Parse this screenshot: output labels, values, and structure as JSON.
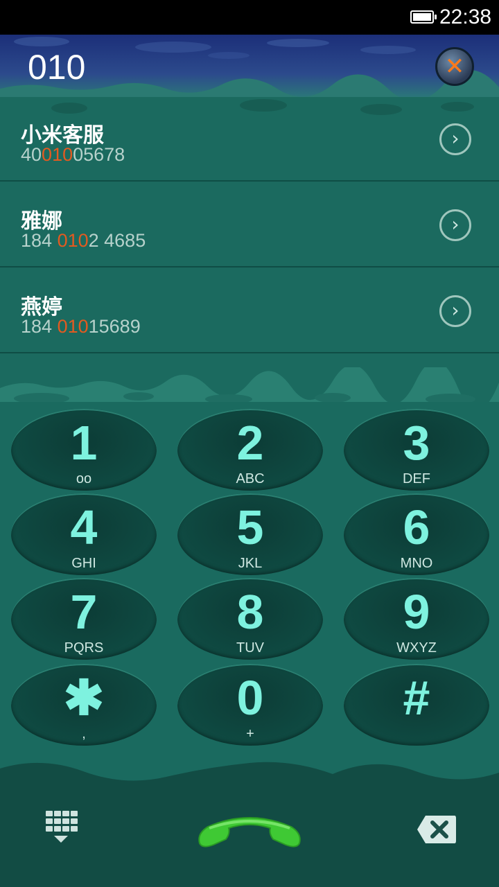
{
  "status_bar": {
    "time": "22:38",
    "battery_level": 1.0,
    "battery_icon": "battery-icon"
  },
  "header": {
    "query": "010",
    "clear_icon": "close-icon",
    "clear_glyph": "✕"
  },
  "results": [
    {
      "name": "小米客服",
      "number_pre": "40",
      "number_match": "010",
      "number_post": "05678"
    },
    {
      "name": "雅娜",
      "number_pre": "184 ",
      "number_match": "010",
      "number_post": "2 4685"
    },
    {
      "name": "燕婷",
      "number_pre": "184 ",
      "number_match": "010",
      "number_post": "15689"
    }
  ],
  "arrow_glyph": "›",
  "keypad": [
    {
      "digit": "1",
      "letters": "ᴏᴏ",
      "letters_icon": "voicemail-icon"
    },
    {
      "digit": "2",
      "letters": "ABC"
    },
    {
      "digit": "3",
      "letters": "DEF"
    },
    {
      "digit": "4",
      "letters": "GHI"
    },
    {
      "digit": "5",
      "letters": "JKL"
    },
    {
      "digit": "6",
      "letters": "MNO"
    },
    {
      "digit": "7",
      "letters": "PQRS"
    },
    {
      "digit": "8",
      "letters": "TUV"
    },
    {
      "digit": "9",
      "letters": "WXYZ"
    },
    {
      "digit": "✱",
      "letters": ","
    },
    {
      "digit": "0",
      "letters": "+"
    },
    {
      "digit": "#",
      "letters": ""
    }
  ],
  "bottom_bar": {
    "dialpad_icon": "dialpad-icon",
    "call_icon": "phone-handset-icon",
    "delete_icon": "backspace-icon"
  },
  "colors": {
    "accent": "#7ef2df",
    "match_highlight": "#e35a20",
    "call_green": "#3fc934"
  }
}
